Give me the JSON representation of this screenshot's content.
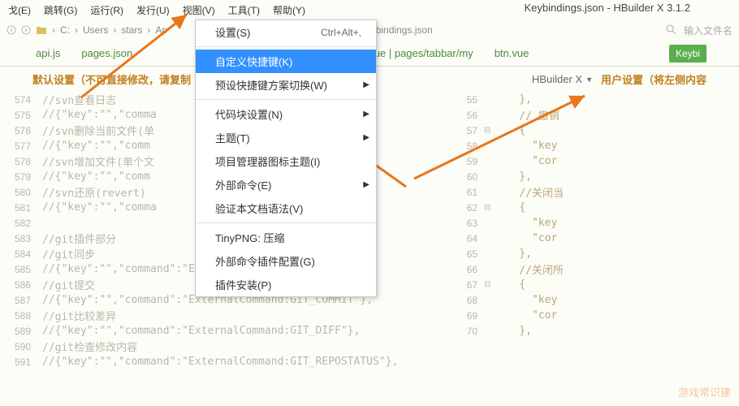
{
  "window_title": "Keybindings.json - HBuilder X 3.1.2",
  "menubar": [
    "戈(E)",
    "跳转(G)",
    "运行(R)",
    "发行(U)",
    "视图(V)",
    "工具(T)",
    "帮助(Y)"
  ],
  "breadcrumbs": [
    "C:",
    "Users",
    "stars",
    "Ap"
  ],
  "breadcrumb_tail": "keybindings.json",
  "search_placeholder": "输入文件名",
  "dropdown": [
    {
      "label": "设置(S)",
      "shortcut": "Ctrl+Alt+,"
    },
    {
      "sep": true
    },
    {
      "label": "自定义快捷键(K)",
      "selected": true
    },
    {
      "label": "预设快捷键方案切换(W)",
      "arrow": true
    },
    {
      "sep": true
    },
    {
      "label": "代码块设置(N)",
      "arrow": true
    },
    {
      "label": "主题(T)",
      "arrow": true
    },
    {
      "label": "项目管理器图标主题(I)"
    },
    {
      "label": "外部命令(E)",
      "arrow": true
    },
    {
      "label": "验证本文档语法(V)"
    },
    {
      "sep": true
    },
    {
      "label": "TinyPNG: 压缩"
    },
    {
      "label": "外部命令插件配置(G)"
    },
    {
      "label": "插件安装(P)"
    }
  ],
  "tabs": {
    "items": [
      "api.js",
      "pages.json",
      "*my.vue | pages/tabbar/my",
      "btn.vue"
    ],
    "last": "Keybi"
  },
  "section_left": "默认设置（不可直接修改，请复制",
  "section_right": "用户设置（将左侧内容",
  "hbuilder_label": "HBuilder X",
  "left_code": [
    {
      "n": 574,
      "t": "//svn查看日志"
    },
    {
      "n": 575,
      "t": "//{\"key\":\"\",\"comma"
    },
    {
      "n": 576,
      "t": "//svn删除当前文件(单"
    },
    {
      "n": 577,
      "t": "//{\"key\":\"\",\"comm                MOVE\"},"
    },
    {
      "n": 578,
      "t": "//svn增加文件(单个文"
    },
    {
      "n": 579,
      "t": "//{\"key\":\"\",\"comm                D\"},"
    },
    {
      "n": 580,
      "t": "//svn还原(revert)"
    },
    {
      "n": 581,
      "t": "//{\"key\":\"\",\"comma                VERT\"},"
    },
    {
      "n": 582,
      "t": ""
    },
    {
      "n": 583,
      "t": "//git插件部分"
    },
    {
      "n": 584,
      "t": "//git同步"
    },
    {
      "n": 585,
      "t": "//{\"key\":\"\",\"command\":\"ExternalCommand:GIT_SYNC\"},"
    },
    {
      "n": 586,
      "t": "//git提交"
    },
    {
      "n": 587,
      "t": "//{\"key\":\"\",\"command\":\"ExternalCommand:GIT_COMMIT\"},"
    },
    {
      "n": 588,
      "t": "//git比较差异"
    },
    {
      "n": 589,
      "t": "//{\"key\":\"\",\"command\":\"ExternalCommand:GIT_DIFF\"},"
    },
    {
      "n": 590,
      "t": "//git检查修改内容"
    },
    {
      "n": 591,
      "t": "//{\"key\":\"\",\"command\":\"ExternalCommand:GIT_REPOSTATUS\"},"
    }
  ],
  "right_code": [
    {
      "n": 55,
      "f": "",
      "t": "    },"
    },
    {
      "n": 56,
      "f": "",
      "t": "    // 撤销 "
    },
    {
      "n": 57,
      "f": "⊟",
      "t": "    {"
    },
    {
      "n": 58,
      "f": "",
      "t": "      \"key"
    },
    {
      "n": 59,
      "f": "",
      "t": "      \"cor"
    },
    {
      "n": 60,
      "f": "",
      "t": "    },"
    },
    {
      "n": 61,
      "f": "",
      "t": "    //关闭当"
    },
    {
      "n": 62,
      "f": "⊟",
      "t": "    {"
    },
    {
      "n": 63,
      "f": "",
      "t": "      \"key"
    },
    {
      "n": 64,
      "f": "",
      "t": "      \"cor"
    },
    {
      "n": 65,
      "f": "",
      "t": "    },"
    },
    {
      "n": 66,
      "f": "",
      "t": "    //关闭所"
    },
    {
      "n": 67,
      "f": "⊟",
      "t": "    {"
    },
    {
      "n": 68,
      "f": "",
      "t": "      \"key"
    },
    {
      "n": 69,
      "f": "",
      "t": "      \"cor"
    },
    {
      "n": 70,
      "f": "",
      "t": "    },"
    }
  ],
  "watermark": "游戏常识建",
  "right_visible": "G\"},"
}
